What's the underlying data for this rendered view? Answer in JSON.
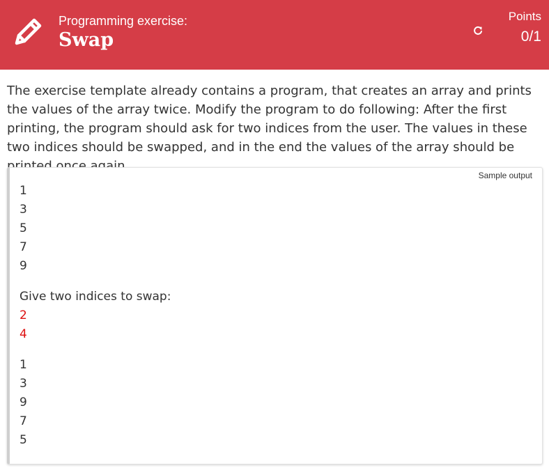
{
  "header": {
    "subtitle": "Programming exercise:",
    "title": "Swap",
    "points_label": "Points",
    "points_value": "0/1",
    "accent_color": "#d53d47"
  },
  "icons": {
    "exercise": "pencil-icon",
    "reset": "refresh-icon"
  },
  "description": "The exercise template already contains a program, that creates an array and prints the values of the array twice. Modify the program to do following: After the first printing, the program should ask for two indices from the user. The values in these two indices should be swapped, and in the end the values of the array should be printed once again.",
  "sample": {
    "label": "Sample output",
    "lines": [
      {
        "text": "1",
        "kind": "output"
      },
      {
        "text": "3",
        "kind": "output"
      },
      {
        "text": "5",
        "kind": "output"
      },
      {
        "text": "7",
        "kind": "output"
      },
      {
        "text": "9",
        "kind": "output"
      },
      {
        "text": "Give two indices to swap:",
        "kind": "output"
      },
      {
        "text": "2",
        "kind": "input"
      },
      {
        "text": "4",
        "kind": "input"
      },
      {
        "text": "1",
        "kind": "output"
      },
      {
        "text": "3",
        "kind": "output"
      },
      {
        "text": "9",
        "kind": "output"
      },
      {
        "text": "7",
        "kind": "output"
      },
      {
        "text": "5",
        "kind": "output"
      }
    ]
  }
}
